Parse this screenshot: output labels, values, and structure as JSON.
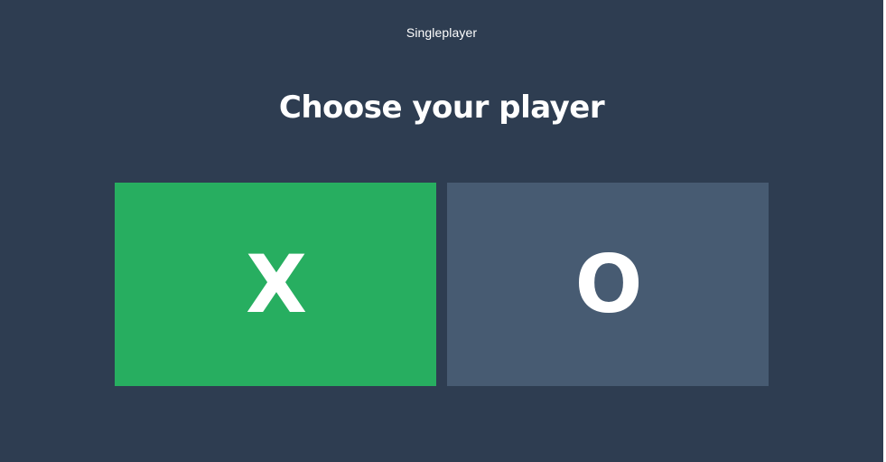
{
  "header": {
    "mode_label": "Singleplayer"
  },
  "main": {
    "heading": "Choose your player",
    "choices": [
      {
        "label": "X",
        "color": "#27ae60",
        "state": "selected"
      },
      {
        "label": "O",
        "color": "#475b72",
        "state": "unselected"
      }
    ]
  },
  "colors": {
    "background": "#2e3d51",
    "text": "#ffffff"
  }
}
